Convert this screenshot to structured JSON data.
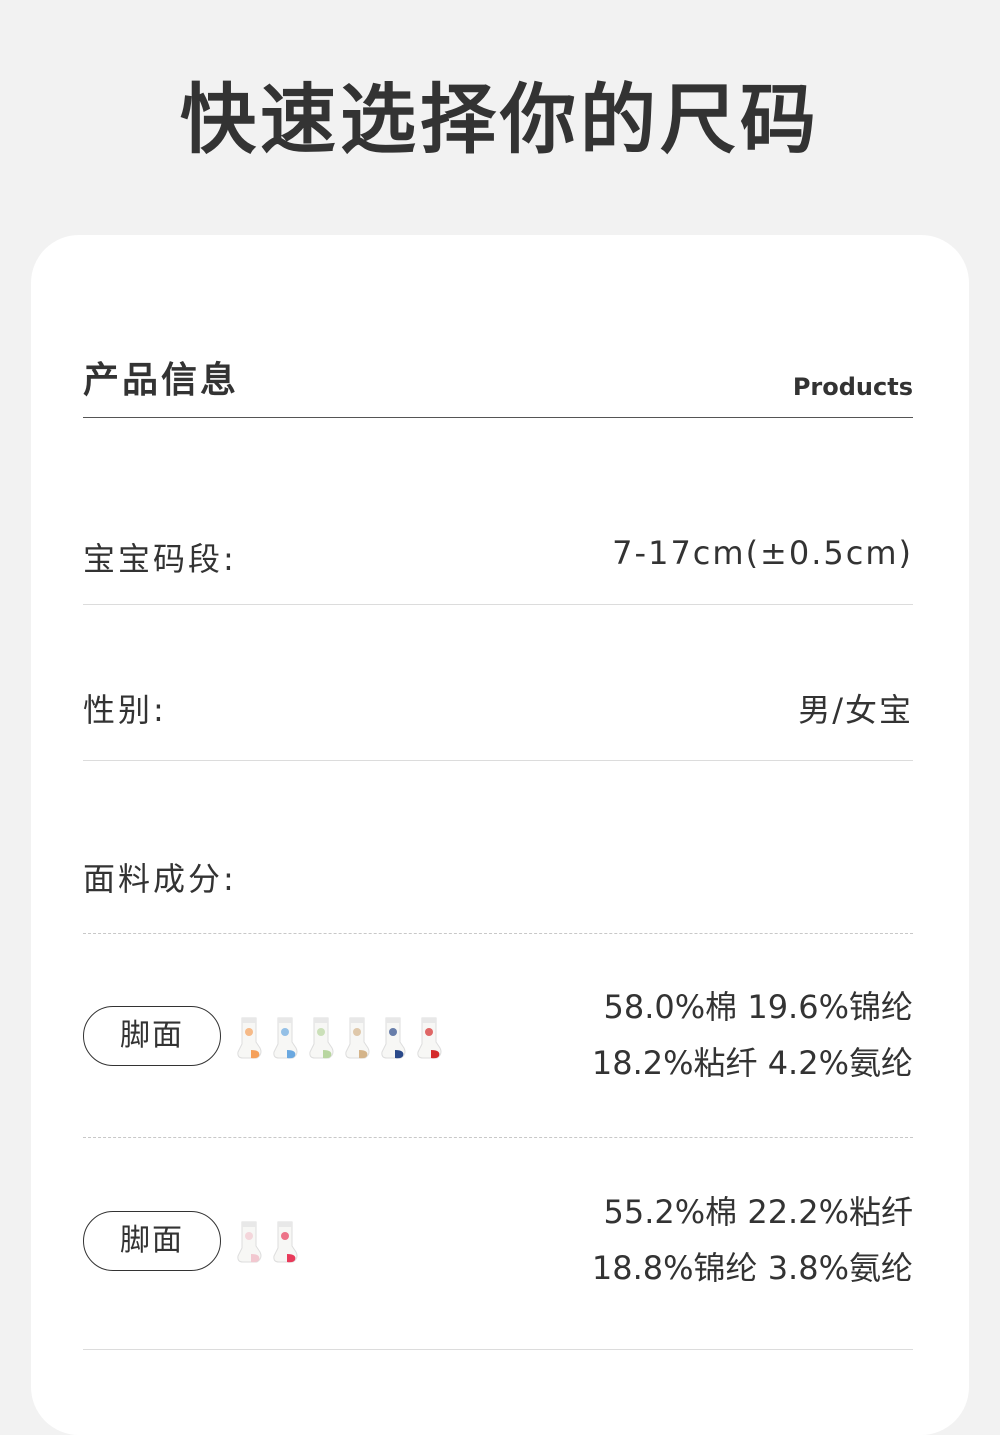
{
  "page_title": "快速选择你的尺码",
  "section": {
    "title": "产品信息",
    "subtitle": "Products"
  },
  "size": {
    "label": "宝宝码段:",
    "value": "7-17cm(±0.5cm)"
  },
  "gender": {
    "label": "性别:",
    "value": "男/女宝"
  },
  "fabric": {
    "label": "面料成分:",
    "groups": [
      {
        "pill": "脚面",
        "line1": "58.0%棉 19.6%锦纶",
        "line2": "18.2%粘纤 4.2%氨纶",
        "sock_colors": [
          "#f5a05a",
          "#6aa8e0",
          "#b8d6a0",
          "#d4b48a",
          "#2b4a8a",
          "#d42a2a"
        ]
      },
      {
        "pill": "脚面",
        "line1": "55.2%棉 22.2%粘纤",
        "line2": "18.8%锦纶 3.8%氨纶",
        "sock_colors": [
          "#f2c8d0",
          "#e83a5a"
        ]
      }
    ]
  }
}
